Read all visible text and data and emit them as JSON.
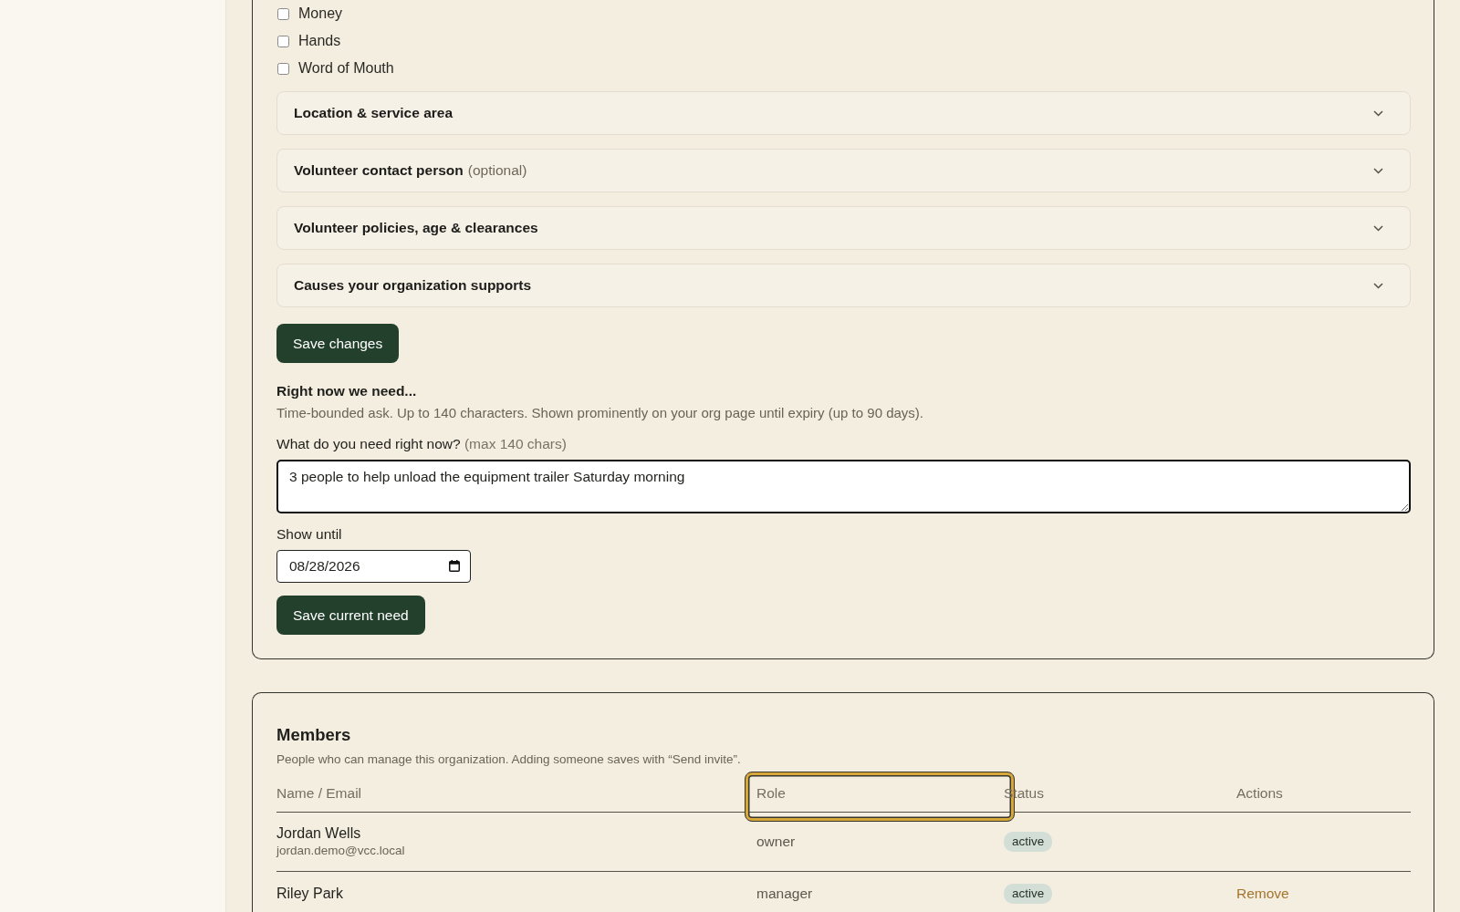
{
  "interest_options": [
    {
      "label": "Money",
      "checked": false
    },
    {
      "label": "Hands",
      "checked": false
    },
    {
      "label": "Word of Mouth",
      "checked": false
    }
  ],
  "sections": [
    {
      "title": "Location & service area",
      "expanded": false
    },
    {
      "title": "Volunteer contact person",
      "note": "(optional)",
      "expanded": false
    },
    {
      "title": "Volunteer policies, age & clearances",
      "expanded": false
    },
    {
      "title": "Causes your organization supports",
      "expanded": false
    }
  ],
  "save_button": "Save changes",
  "current_need": {
    "heading": "Right now we need...",
    "description": "Time-bounded ask. Up to 140 characters. Shown prominently on your org page until expiry (up to 90 days).",
    "need_label": "What do you need right now?",
    "need_hint": "(max 140 chars)",
    "need_value": "3 people to help unload the equipment trailer Saturday morning",
    "date_label": "Show until",
    "date_value": "08/28/2026",
    "save_button": "Save current need"
  },
  "members": {
    "title": "Members",
    "description": "People who can manage this organization. Adding someone saves with “Send invite”.",
    "columns": [
      {
        "label": "Name / Email",
        "focused": false
      },
      {
        "label": "Role",
        "focused": true
      },
      {
        "label": "Status",
        "focused": false
      },
      {
        "label": "Actions",
        "focused": false
      }
    ],
    "rows": [
      {
        "name": "Jordan Wells",
        "email": "jordan.demo@vcc.local",
        "role": "owner",
        "status": "active"
      },
      {
        "name": "Riley Park",
        "role": "manager",
        "status": "active",
        "action": "Remove"
      }
    ]
  }
}
